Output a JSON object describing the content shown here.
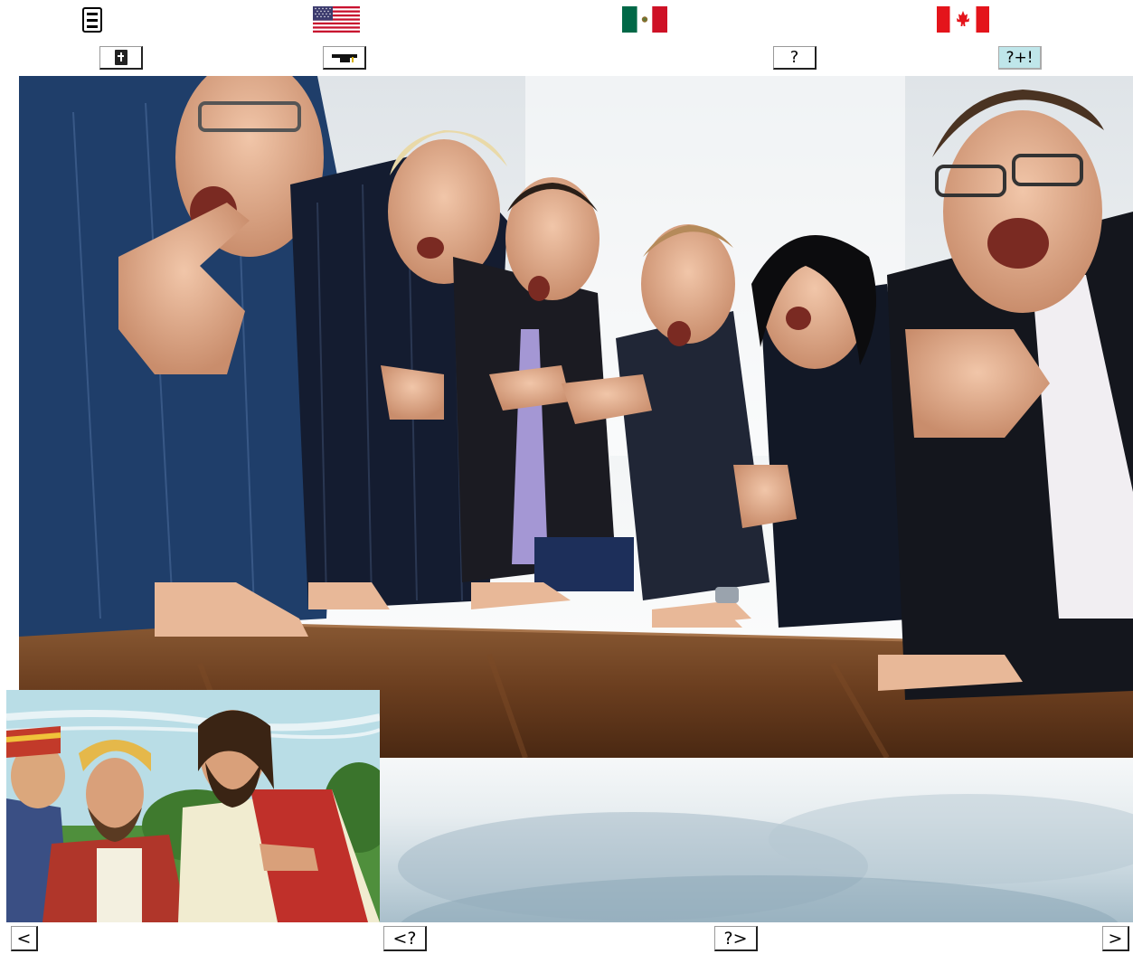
{
  "top_nav": {
    "menu_icon": "hamburger-menu-icon",
    "flags": [
      {
        "icon": "us-flag-icon",
        "colors": {
          "red": "#c8102e",
          "white": "#ffffff",
          "blue": "#3c3b6e"
        }
      },
      {
        "icon": "mexico-flag-icon",
        "colors": {
          "green": "#006847",
          "white": "#ffffff",
          "red": "#ce1126"
        }
      },
      {
        "icon": "canada-flag-icon",
        "colors": {
          "red": "#e4141b",
          "white": "#ffffff"
        }
      }
    ]
  },
  "toolbar": {
    "bible_icon": "bible-icon",
    "graduation_icon": "graduation-cap-icon",
    "question_label": "?",
    "answer_label": "?+!",
    "answer_bg": "#bfe6ea"
  },
  "bottom_nav": {
    "prev_label": "<",
    "prev_question_label": "<?",
    "next_question_label": "?>",
    "next_label": ">"
  }
}
